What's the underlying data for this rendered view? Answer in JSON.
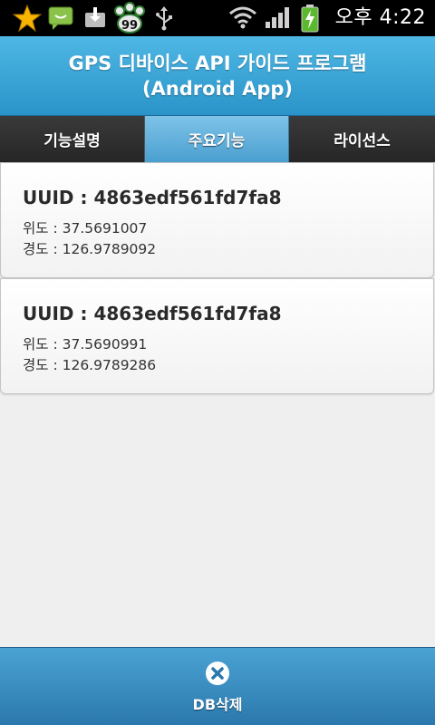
{
  "status_bar": {
    "notification_badge": "99",
    "time": "오후 4:22",
    "icons": [
      "star-icon",
      "chat-icon",
      "download-icon",
      "paw-icon",
      "usb-icon",
      "wifi-icon",
      "signal-icon",
      "battery-charging-icon"
    ]
  },
  "header": {
    "title_line1": "GPS 디바이스 API 가이드 프로그램",
    "title_line2": "(Android App)"
  },
  "tabs": [
    {
      "label": "기능설명",
      "active": false
    },
    {
      "label": "주요기능",
      "active": true
    },
    {
      "label": "라이선스",
      "active": false
    }
  ],
  "items": [
    {
      "uuid": "UUID : 4863edf561fd7fa8",
      "lat": "위도 : 37.5691007",
      "lng": "경도 : 126.9789092"
    },
    {
      "uuid": "UUID : 4863edf561fd7fa8",
      "lat": "위도 : 37.5690991",
      "lng": "경도 : 126.9789286"
    }
  ],
  "bottom_button": {
    "label": "DB삭제",
    "icon": "delete-icon"
  },
  "colors": {
    "header": "#3aa6d8",
    "tab_active": "#5fb0dd",
    "tab_inactive": "#2f2f2f",
    "bottom_bar": "#3a8fc2"
  }
}
